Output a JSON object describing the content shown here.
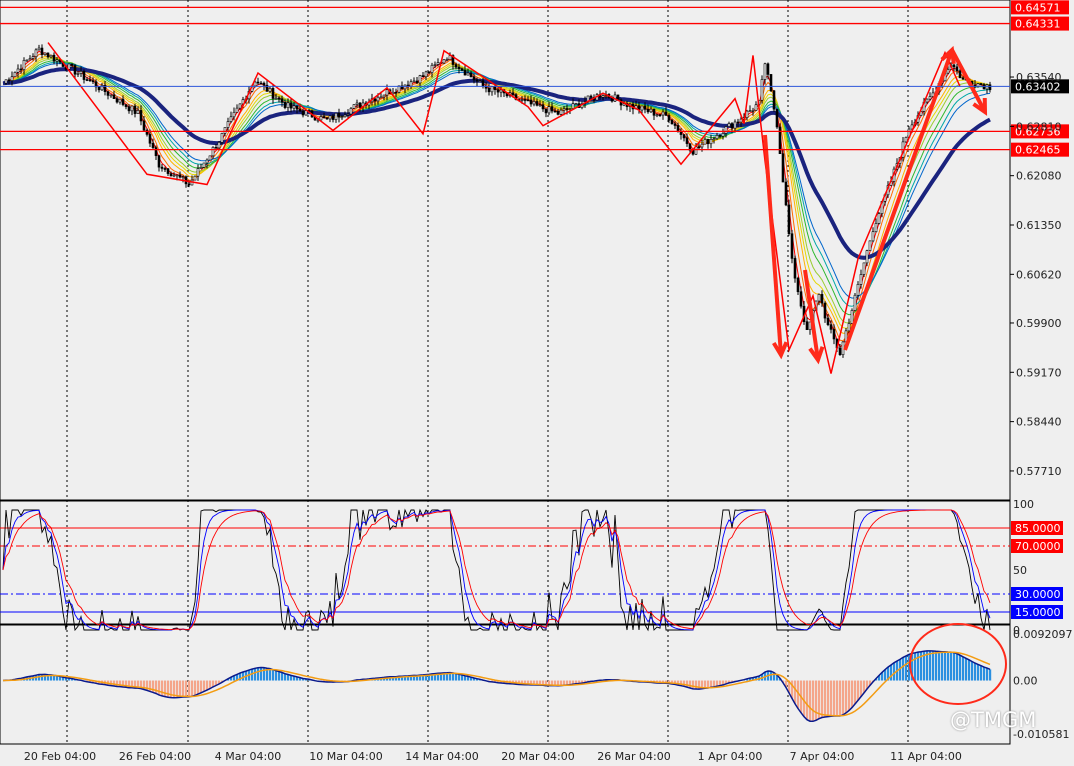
{
  "watermark": "@TMGM",
  "chart_data": [
    {
      "type": "candlestick",
      "title": "",
      "ylim": [
        0.5728,
        0.6468
      ],
      "y_ticks": [
        0.5771,
        0.5844,
        0.5917,
        0.599,
        0.6062,
        0.6135,
        0.6208,
        0.6281,
        0.6354
      ],
      "y_tick_labels": [
        "0.57710",
        "0.58440",
        "0.59170",
        "0.59900",
        "0.60620",
        "0.61350",
        "0.62080",
        "0.62810",
        "0.63540"
      ],
      "horizontal_levels": [
        {
          "value": 0.64571,
          "label": "0.64571",
          "color": "#ff0000"
        },
        {
          "value": 0.64331,
          "label": "0.64331",
          "color": "#ff0000"
        },
        {
          "value": 0.62736,
          "label": "0.62736",
          "color": "#ff0000"
        },
        {
          "value": 0.62465,
          "label": "0.62465",
          "color": "#ff0000"
        }
      ],
      "current_price": {
        "value": 0.63402,
        "label": "0.63402",
        "color": "#2b55d9"
      },
      "ma_colors": [
        "#ff0000",
        "#ff6a00",
        "#ffb300",
        "#e6d800",
        "#9acd32",
        "#2eb82e",
        "#00a7a7",
        "#0066cc"
      ],
      "trend_ma_color": "#1a237e"
    },
    {
      "type": "line",
      "title": "",
      "ylim": [
        0,
        100
      ],
      "y_tick_labels": [
        "100",
        "50",
        "0"
      ],
      "levels": [
        {
          "value": 85,
          "label": "85.0000",
          "color": "#ff0000",
          "style": "solid"
        },
        {
          "value": 70,
          "label": "70.0000",
          "color": "#ff0000",
          "style": "dashdot"
        },
        {
          "value": 30,
          "label": "30.0000",
          "color": "#0000ff",
          "style": "dashdot"
        },
        {
          "value": 15,
          "label": "15.0000",
          "color": "#0000ff",
          "style": "solid"
        }
      ],
      "series_colors": [
        "#000000",
        "#0000ff",
        "#ff0000"
      ]
    },
    {
      "type": "bar",
      "title": "",
      "ylim": [
        -0.010581,
        0.0092097
      ],
      "y_tick_labels": [
        "0.0092097",
        "0.00",
        "-0.010581"
      ],
      "hist_pos_color": "#2a8fe0",
      "hist_neg_color": "#f4a58a",
      "macd_color": "#0a1a8c",
      "signal_color": "#f39c12"
    }
  ],
  "x_axis": {
    "labels": [
      "20 Feb 04:00",
      "26 Feb 04:00",
      "4 Mar 04:00",
      "10 Mar 04:00",
      "14 Mar 04:00",
      "20 Mar 04:00",
      "26 Mar 04:00",
      "1 Apr 04:00",
      "7 Apr 04:00",
      "11 Apr 04:00"
    ]
  }
}
